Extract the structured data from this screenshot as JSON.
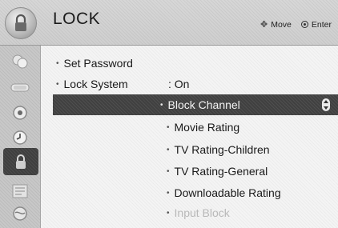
{
  "header": {
    "title": "LOCK",
    "move_label": "Move",
    "enter_label": "Enter"
  },
  "sidebar": {
    "items": [
      {
        "icon": "picture-icon"
      },
      {
        "icon": "audio-icon"
      },
      {
        "icon": "setup-icon"
      },
      {
        "icon": "time-icon"
      },
      {
        "icon": "lock-icon",
        "active": true
      },
      {
        "icon": "option-icon"
      },
      {
        "icon": "network-icon"
      }
    ]
  },
  "menu": {
    "set_password": "Set Password",
    "lock_system": "Lock System",
    "lock_system_value": ": On",
    "block_channel": "Block Channel",
    "movie_rating": "Movie Rating",
    "tv_rating_children": "TV Rating-Children",
    "tv_rating_general": "TV Rating-General",
    "downloadable_rating": "Downloadable Rating",
    "input_block": "Input Block"
  }
}
